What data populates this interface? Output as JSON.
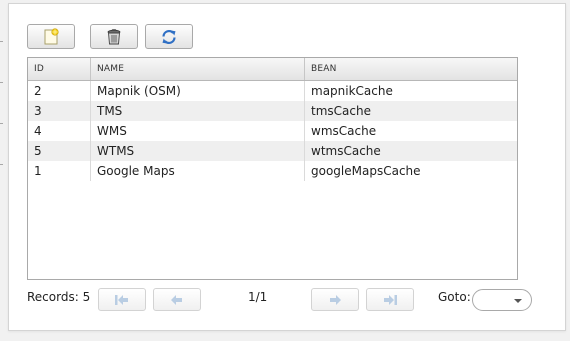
{
  "toolbar": {
    "buttons": [
      {
        "icon": "new-document-icon"
      },
      {
        "icon": "trash-can-icon"
      },
      {
        "icon": "refresh-icon"
      }
    ]
  },
  "table": {
    "columns": [
      "ID",
      "NAME",
      "BEAN"
    ],
    "rows": [
      {
        "id": "2",
        "name": "Mapnik (OSM)",
        "bean": "mapnikCache"
      },
      {
        "id": "3",
        "name": "TMS",
        "bean": "tmsCache"
      },
      {
        "id": "4",
        "name": "WMS",
        "bean": "wmsCache"
      },
      {
        "id": "5",
        "name": "WTMS",
        "bean": "wtmsCache"
      },
      {
        "id": "1",
        "name": "Google Maps",
        "bean": "googleMapsCache"
      }
    ]
  },
  "pager": {
    "records_label": "Records: 5",
    "page_info": "1/1",
    "goto_label": "Goto:",
    "goto_value": "",
    "buttons": [
      {
        "icon": "first-page-icon"
      },
      {
        "icon": "previous-page-icon"
      },
      {
        "icon": "next-page-icon"
      },
      {
        "icon": "last-page-icon"
      }
    ]
  },
  "colors": {
    "accent_blue": "#2f6fc4",
    "icon_disabled": "#b9cde3",
    "row_alt": "#efefef"
  }
}
